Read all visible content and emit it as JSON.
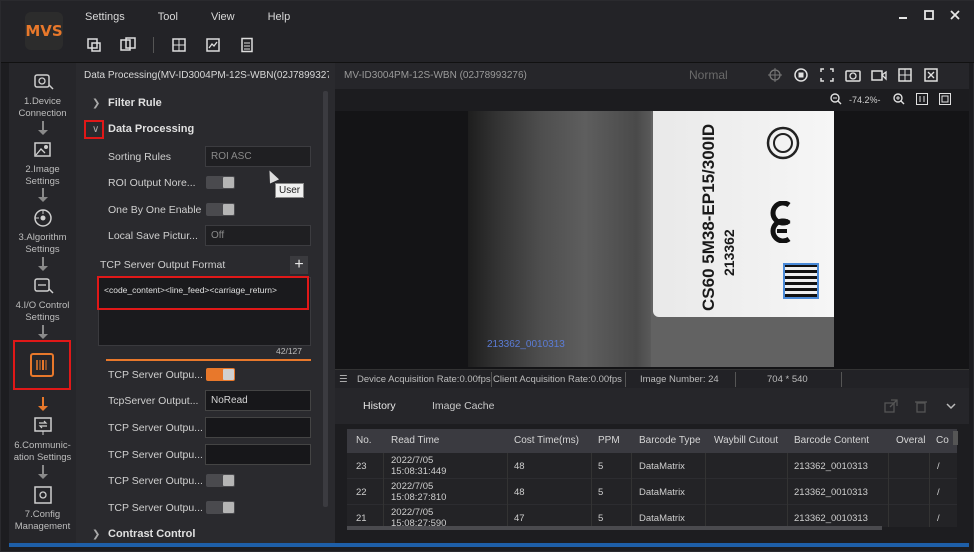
{
  "menu": [
    "Settings",
    "Tool",
    "View",
    "Help"
  ],
  "logo_text": "MVS",
  "toolbar_icons": [
    "new-window-icon",
    "multi-window-icon",
    "grid-icon",
    "chart-icon",
    "document-icon"
  ],
  "window_controls": {
    "minimize": "▬",
    "maximize": "■",
    "close": "✕"
  },
  "nav_steps": [
    {
      "label": "1.Device Connection",
      "icon": "device-connection-icon"
    },
    {
      "label": "2.Image Settings",
      "icon": "image-settings-icon"
    },
    {
      "label": "3.Algorithm Settings",
      "icon": "algorithm-icon"
    },
    {
      "label": "4.I/O Control Settings",
      "icon": "io-control-icon"
    },
    {
      "label": "",
      "icon": "barcode-output-icon"
    },
    {
      "label": "6.Communic-ation Settings",
      "icon": "communication-icon"
    },
    {
      "label": "7.Config Management",
      "icon": "config-icon"
    }
  ],
  "panel": {
    "title": "Data Processing(MV-ID3004PM-12S-WBN(02J7899327",
    "filter_rule": "Filter Rule",
    "data_processing": "Data Processing",
    "contrast_control": "Contrast Control",
    "rows": [
      {
        "label": "Sorting Rules",
        "value": "ROI ASC"
      },
      {
        "label": "ROI Output Nore...",
        "value": ""
      },
      {
        "label": "One By One Enable",
        "value": ""
      },
      {
        "label": "Local Save Pictur...",
        "value": "Off"
      }
    ],
    "tcp_format_label": "TCP Server Output Format",
    "tcp_format_value": "<code_content><line_feed><carriage_return>",
    "counter": "42/127",
    "tcp_rows": [
      {
        "label": "TCP Server Outpu...",
        "value": ""
      },
      {
        "label": "TcpServer Output...",
        "value": "NoRead"
      },
      {
        "label": "TCP Server Outpu...",
        "value": ""
      },
      {
        "label": "TCP Server Outpu...",
        "value": ""
      },
      {
        "label": "TCP Server Outpu...",
        "value": ""
      },
      {
        "label": "TCP Server Outpu...",
        "value": ""
      }
    ],
    "tooltip": "User"
  },
  "view": {
    "title": "MV-ID3004PM-12S-WBN (02J78993276)",
    "mode": "Normal",
    "zoom": "-74.2%-",
    "overlay_code": "213362_0010313",
    "label_lines": [
      "CS60 5M38-EP15/300ID",
      "213362"
    ]
  },
  "status": {
    "device_rate": "Device Acquisition Rate:0.00fps",
    "client_rate": "Client Acquisition Rate:0.00fps",
    "image_number": "Image Number: 24",
    "resolution": "704 * 540"
  },
  "history": {
    "tabs": [
      "History",
      "Image Cache"
    ],
    "columns": [
      "No.",
      "Read Time",
      "Cost Time(ms)",
      "PPM",
      "Barcode Type",
      "Waybill Cutout",
      "Barcode Content",
      "Overal",
      "Co"
    ],
    "rows": [
      {
        "no": "23",
        "date": "2022/7/05",
        "time": "15:08:31:449",
        "cost": "48",
        "ppm": "5",
        "type": "DataMatrix",
        "content": "213362_0010313",
        "co": "/"
      },
      {
        "no": "22",
        "date": "2022/7/05",
        "time": "15:08:27:810",
        "cost": "48",
        "ppm": "5",
        "type": "DataMatrix",
        "content": "213362_0010313",
        "co": "/"
      },
      {
        "no": "21",
        "date": "2022/7/05",
        "time": "15:08:27:590",
        "cost": "47",
        "ppm": "5",
        "type": "DataMatrix",
        "content": "213362_0010313",
        "co": "/"
      }
    ]
  }
}
